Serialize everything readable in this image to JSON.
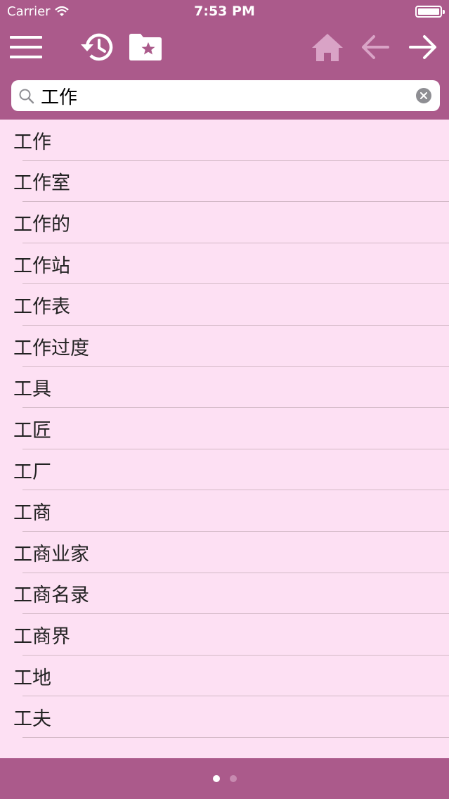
{
  "status_bar": {
    "carrier": "Carrier",
    "time": "7:53 PM"
  },
  "toolbar": {
    "icons": [
      "menu-icon",
      "history-icon",
      "favorites-folder-icon",
      "home-icon",
      "back-arrow-icon",
      "forward-arrow-icon"
    ]
  },
  "search": {
    "value": "工作",
    "placeholder": ""
  },
  "results": [
    "工作",
    "工作室",
    "工作的",
    "工作站",
    "工作表",
    "工作过度",
    "工具",
    "工匠",
    "工厂",
    "工商",
    "工商业家",
    "工商名录",
    "工商界",
    "工地",
    "工夫"
  ],
  "pager": {
    "pages": 2,
    "current": 1
  },
  "colors": {
    "bar": "#ab5a8b",
    "list_bg": "#fde0f3",
    "disabled_icon": "#d9a3c6"
  }
}
